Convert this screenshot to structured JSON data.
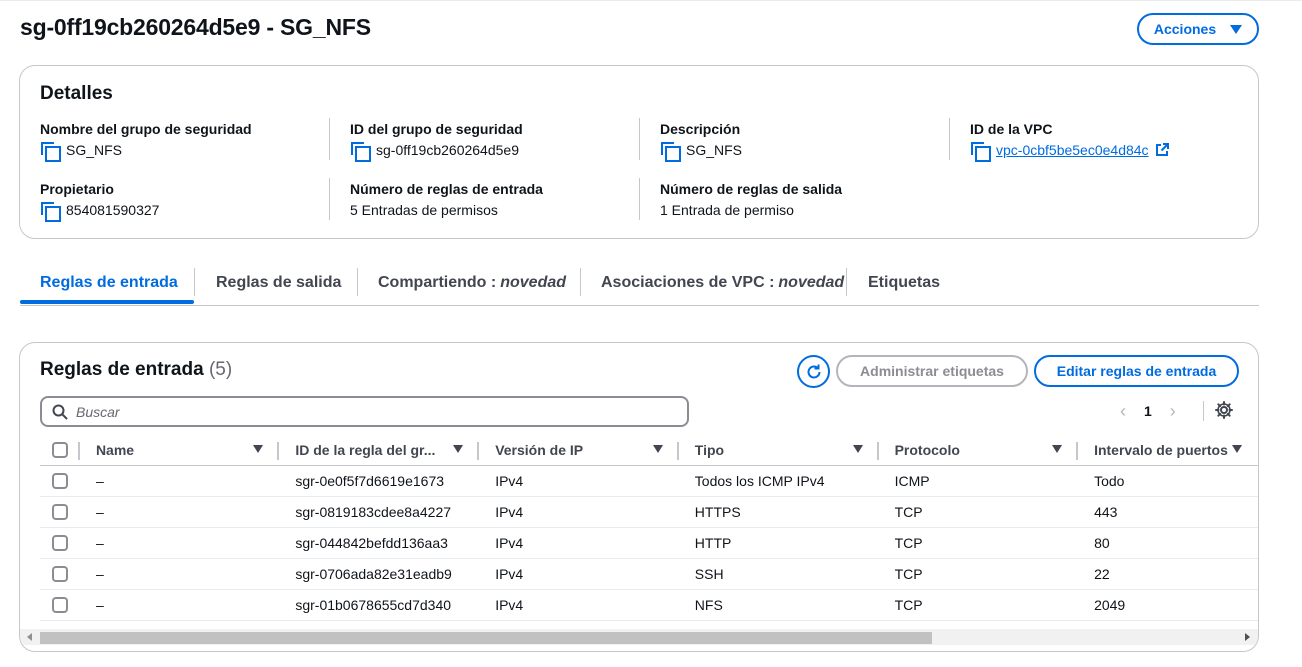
{
  "header": {
    "title": "sg-0ff19cb260264d5e9 - SG_NFS",
    "actions_label": "Acciones"
  },
  "details": {
    "title": "Detalles",
    "fields": {
      "sg_name": {
        "label": "Nombre del grupo de seguridad",
        "value": "SG_NFS"
      },
      "sg_id": {
        "label": "ID del grupo de seguridad",
        "value": "sg-0ff19cb260264d5e9"
      },
      "description": {
        "label": "Descripción",
        "value": "SG_NFS"
      },
      "vpc_id": {
        "label": "ID de la VPC",
        "value": "vpc-0cbf5be5ec0e4d84c"
      },
      "owner": {
        "label": "Propietario",
        "value": "854081590327"
      },
      "inbound_count": {
        "label": "Número de reglas de entrada",
        "value": "5 Entradas de permisos"
      },
      "outbound_count": {
        "label": "Número de reglas de salida",
        "value": "1 Entrada de permiso"
      }
    }
  },
  "tabs": [
    {
      "label": "Reglas de entrada",
      "badge": "",
      "active": true
    },
    {
      "label": "Reglas de salida",
      "badge": "",
      "active": false
    },
    {
      "label": "Compartiendo :",
      "badge": "novedad",
      "active": false
    },
    {
      "label": "Asociaciones de VPC :",
      "badge": "novedad",
      "active": false
    },
    {
      "label": "Etiquetas",
      "badge": "",
      "active": false
    }
  ],
  "rules": {
    "title": "Reglas de entrada",
    "count": "(5)",
    "manage_tags_label": "Administrar etiquetas",
    "edit_rules_label": "Editar reglas de entrada",
    "search_placeholder": "Buscar",
    "current_page": "1",
    "columns": [
      "Name",
      "ID de la regla del gr...",
      "Versión de IP",
      "Tipo",
      "Protocolo",
      "Intervalo de puertos"
    ],
    "rows": [
      [
        "–",
        "sgr-0e0f5f7d6619e1673",
        "IPv4",
        "Todos los ICMP IPv4",
        "ICMP",
        "Todo"
      ],
      [
        "–",
        "sgr-0819183cdee8a4227",
        "IPv4",
        "HTTPS",
        "TCP",
        "443"
      ],
      [
        "–",
        "sgr-044842befdd136aa3",
        "IPv4",
        "HTTP",
        "TCP",
        "80"
      ],
      [
        "–",
        "sgr-0706ada82e31eadb9",
        "IPv4",
        "SSH",
        "TCP",
        "22"
      ],
      [
        "–",
        "sgr-01b0678655cd7d340",
        "IPv4",
        "NFS",
        "TCP",
        "2049"
      ]
    ]
  },
  "colors": {
    "accent": "#006ce0",
    "border": "#c6c6cd",
    "text": "#0f141a",
    "disabled": "#8c8c94"
  },
  "icons": [
    "copy-icon",
    "external-link-icon",
    "refresh-icon",
    "search-icon",
    "chevron-left-icon",
    "chevron-right-icon",
    "gear-icon",
    "caret-down-icon",
    "sort-icon"
  ]
}
